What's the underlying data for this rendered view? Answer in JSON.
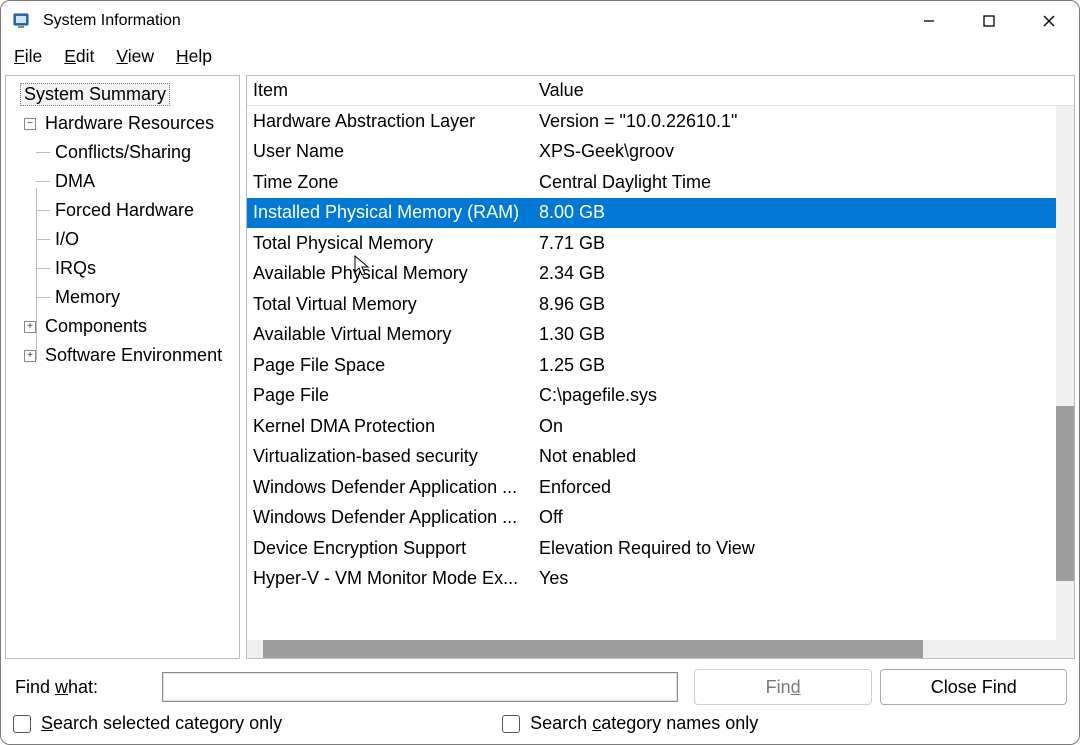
{
  "window": {
    "title": "System Information"
  },
  "menu": {
    "file": "File",
    "edit": "Edit",
    "view": "View",
    "help": "Help"
  },
  "tree": {
    "root": "System Summary",
    "hardware": "Hardware Resources",
    "conflicts": "Conflicts/Sharing",
    "dma": "DMA",
    "forced": "Forced Hardware",
    "io": "I/O",
    "irqs": "IRQs",
    "memory": "Memory",
    "components": "Components",
    "software_env": "Software Environment"
  },
  "list": {
    "header_item": "Item",
    "header_value": "Value",
    "rows": [
      {
        "item": "Hardware Abstraction Layer",
        "value": "Version = \"10.0.22610.1\""
      },
      {
        "item": "User Name",
        "value": "XPS-Geek\\groov"
      },
      {
        "item": "Time Zone",
        "value": "Central Daylight Time"
      },
      {
        "item": "Installed Physical Memory (RAM)",
        "value": "8.00 GB",
        "selected": true
      },
      {
        "item": "Total Physical Memory",
        "value": "7.71 GB"
      },
      {
        "item": "Available Physical Memory",
        "value": "2.34 GB"
      },
      {
        "item": "Total Virtual Memory",
        "value": "8.96 GB"
      },
      {
        "item": "Available Virtual Memory",
        "value": "1.30 GB"
      },
      {
        "item": "Page File Space",
        "value": "1.25 GB"
      },
      {
        "item": "Page File",
        "value": "C:\\pagefile.sys"
      },
      {
        "item": "Kernel DMA Protection",
        "value": "On"
      },
      {
        "item": "Virtualization-based security",
        "value": "Not enabled"
      },
      {
        "item": "Windows Defender Application ...",
        "value": "Enforced"
      },
      {
        "item": "Windows Defender Application ...",
        "value": "Off"
      },
      {
        "item": "Device Encryption Support",
        "value": "Elevation Required to View"
      },
      {
        "item": "Hyper-V - VM Monitor Mode Ex...",
        "value": "Yes"
      }
    ]
  },
  "footer": {
    "find_what_label": "Find what:",
    "find_button": "Find",
    "close_find_button": "Close Find",
    "search_selected": "Search selected category only",
    "search_names": "Search category names only"
  }
}
